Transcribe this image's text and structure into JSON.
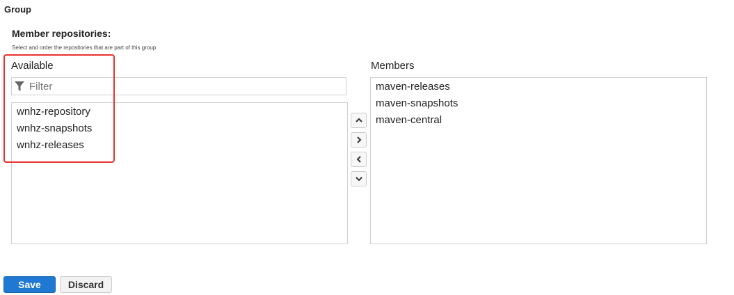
{
  "section": {
    "title": "Group"
  },
  "member_repositories": {
    "heading": "Member repositories:",
    "description": "Select and order the repositories that are part of this group"
  },
  "available": {
    "label": "Available",
    "filter_placeholder": "Filter",
    "items": [
      "wnhz-repository",
      "wnhz-snapshots",
      "wnhz-releases"
    ]
  },
  "members": {
    "label": "Members",
    "items": [
      "maven-releases",
      "maven-snapshots",
      "maven-central"
    ]
  },
  "icons": {
    "filter": "filter-funnel-icon",
    "move_up": "chevron-up-icon",
    "move_right": "chevron-right-icon",
    "move_left": "chevron-left-icon",
    "move_down": "chevron-down-icon"
  },
  "actions": {
    "save_label": "Save",
    "discard_label": "Discard"
  },
  "colors": {
    "primary_button": "#1f78d1",
    "highlight_border": "#e8322f",
    "border": "#cfcfcf"
  }
}
